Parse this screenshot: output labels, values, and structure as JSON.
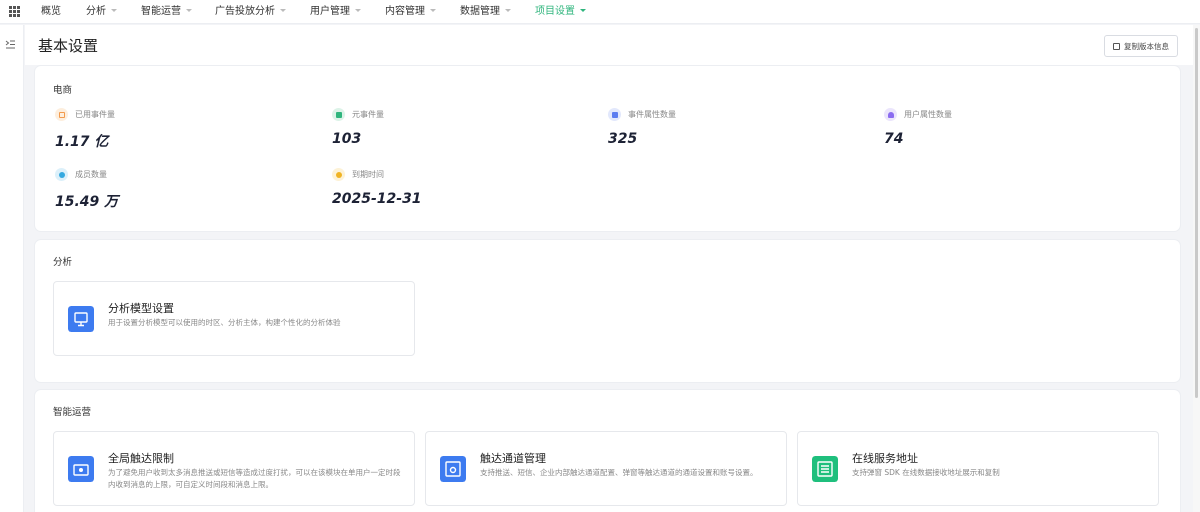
{
  "nav": {
    "items": [
      {
        "label": "概览",
        "dropdown": false
      },
      {
        "label": "分析",
        "dropdown": true
      },
      {
        "label": "智能运营",
        "dropdown": true
      },
      {
        "label": "广告投放分析",
        "dropdown": true
      },
      {
        "label": "用户管理",
        "dropdown": true
      },
      {
        "label": "内容管理",
        "dropdown": true
      },
      {
        "label": "数据管理",
        "dropdown": true
      },
      {
        "label": "项目设置",
        "dropdown": true,
        "active": true
      }
    ],
    "active_color": "#2fb57d"
  },
  "header": {
    "title": "基本设置",
    "copy_label": "复制版本信息"
  },
  "ecommerce": {
    "title": "电商",
    "stats": [
      {
        "label": "已用事件量",
        "value": "1.17 亿",
        "icon": "event-usage-icon",
        "color": "#f39a4c",
        "bg": "#fdeedd"
      },
      {
        "label": "元事件量",
        "value": "103",
        "icon": "meta-event-icon",
        "color": "#2fb57d",
        "bg": "#dcf3e8"
      },
      {
        "label": "事件属性数量",
        "value": "325",
        "icon": "event-property-icon",
        "color": "#5b7cf0",
        "bg": "#e2e8fc"
      },
      {
        "label": "用户属性数量",
        "value": "74",
        "icon": "user-property-icon",
        "color": "#8b6cf0",
        "bg": "#ebe5fc"
      },
      {
        "label": "成员数量",
        "value": "15.49 万",
        "icon": "members-icon",
        "color": "#35a9e0",
        "bg": "#dcf0fa"
      },
      {
        "label": "到期时间",
        "value": "2025-12-31",
        "icon": "expiry-time-icon",
        "color": "#f0b323",
        "bg": "#fdf2d6"
      }
    ]
  },
  "analysis": {
    "title": "分析",
    "cards": [
      {
        "title": "分析模型设置",
        "desc": "用于设置分析模型可以使用的时区、分析主体，构建个性化的分析体验",
        "icon": "analysis-model-icon",
        "color": "#3d7bf0"
      }
    ]
  },
  "operations": {
    "title": "智能运营",
    "cards": [
      {
        "title": "全局触达限制",
        "desc": "为了避免用户收到太多消息推送或短信等造成过度打扰，可以在该模块在单用户一定时段内收到消息的上限，可自定义时间段和消息上限。",
        "icon": "global-reach-limit-icon",
        "color": "#3d7bf0"
      },
      {
        "title": "触达通道管理",
        "desc": "支持推送、短信、企业内部触达通道配置、弹窗等触达通道的通道设置和账号设置。",
        "icon": "reach-channel-icon",
        "color": "#3d7bf0"
      },
      {
        "title": "在线服务地址",
        "desc": "支持弹窗 SDK 在线数据接收地址展示和复制",
        "icon": "online-service-icon",
        "color": "#1fbf7d"
      }
    ]
  }
}
